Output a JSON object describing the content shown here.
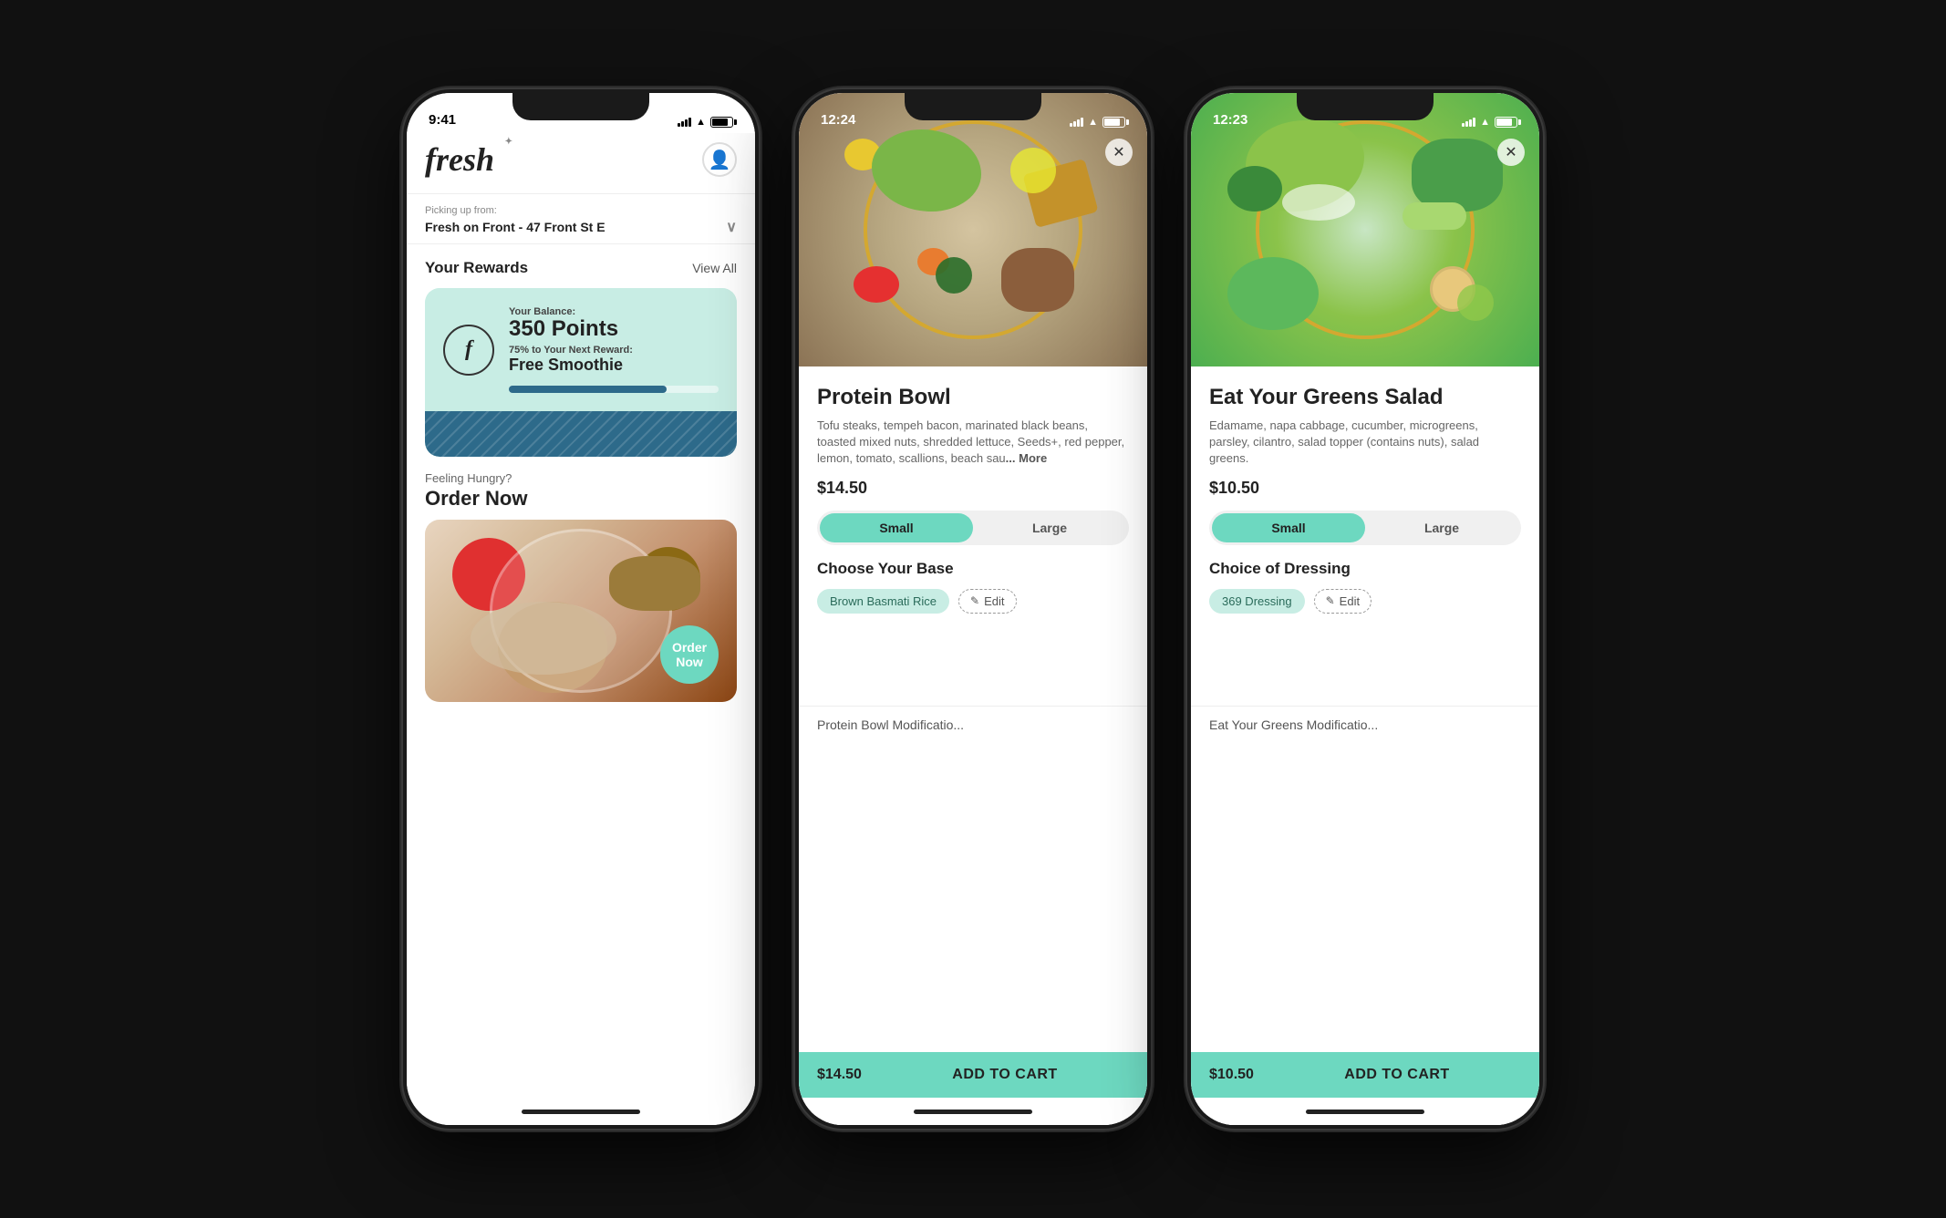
{
  "phone1": {
    "status_time": "9:41",
    "status_signal": "●●●",
    "picking_up_label": "Picking up from:",
    "picking_up_location": "Fresh on Front - 47 Front St E",
    "rewards_section_title": "Your Rewards",
    "rewards_view_all": "View All",
    "rewards_balance_label": "Your Balance:",
    "rewards_points": "350 Points",
    "rewards_next_label": "75% to Your Next Reward:",
    "rewards_next": "Free Smoothie",
    "hungry_label": "Feeling Hungry?",
    "order_now": "Order Now",
    "order_badge": "Order Now"
  },
  "phone2": {
    "status_time": "12:24",
    "product_name": "Protein Bowl",
    "product_description": "Tofu steaks, tempeh bacon, marinated black beans, toasted mixed nuts, shredded lettuce, Seeds+, red pepper, lemon, tomato, scallions, beach sau",
    "more_text": "... More",
    "price": "$14.50",
    "size_small": "Small",
    "size_large": "Large",
    "base_section_title": "Choose Your Base",
    "base_selected": "Brown Basmati Rice",
    "edit_label": "Edit",
    "modify_label": "Protein Bowl Modificatio...",
    "cart_price": "$14.50",
    "add_to_cart": "ADD TO CART"
  },
  "phone3": {
    "status_time": "12:23",
    "product_name": "Eat Your Greens Salad",
    "product_description": "Edamame, napa cabbage, cucumber, microgreens, parsley, cilantro, salad topper (contains nuts), salad greens.",
    "price": "$10.50",
    "size_small": "Small",
    "size_large": "Large",
    "dressing_section_title": "Choice of Dressing",
    "dressing_selected": "369 Dressing",
    "edit_label": "Edit",
    "modify_label": "Eat Your Greens Modificatio...",
    "cart_price": "$10.50",
    "add_to_cart": "ADD TO CART"
  }
}
